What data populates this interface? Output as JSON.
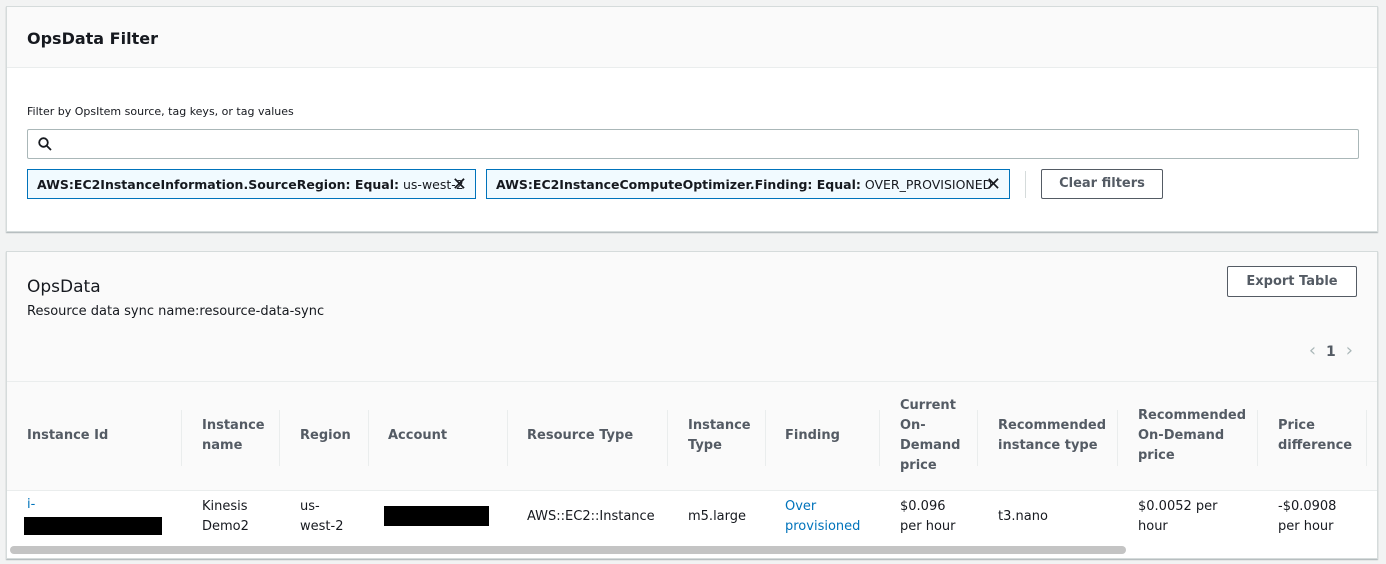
{
  "filter_panel": {
    "title": "OpsData Filter",
    "label": "Filter by OpsItem source, tag keys, or tag values",
    "search_placeholder": "",
    "tokens": [
      {
        "key": "AWS:EC2InstanceInformation.SourceRegion: Equal:",
        "value": "us-west-2"
      },
      {
        "key": "AWS:EC2InstanceComputeOptimizer.Finding: Equal:",
        "value": "OVER_PROVISIONED"
      }
    ],
    "clear_label": "Clear filters"
  },
  "ops_panel": {
    "title": "OpsData",
    "subtitle": "Resource data sync name:resource-data-sync",
    "export_label": "Export Table",
    "page": "1"
  },
  "table": {
    "headers": [
      "Instance Id",
      "Instance name",
      "Region",
      "Account",
      "Resource Type",
      "Instance Type",
      "Finding",
      "Current On-Demand price",
      "Recommended instance type",
      "Recommended On-Demand price",
      "Price difference"
    ],
    "row": {
      "instance_id": "i-",
      "instance_name": "Kinesis Demo2",
      "region": "us-west-2",
      "account": "",
      "resource_type": "AWS::EC2::Instance",
      "instance_type": "m5.large",
      "finding": "Over provisioned",
      "current_price": "$0.096 per hour",
      "recommended_type": "t3.nano",
      "recommended_price": "$0.0052 per hour",
      "price_difference": "-$0.0908 per hour"
    }
  }
}
